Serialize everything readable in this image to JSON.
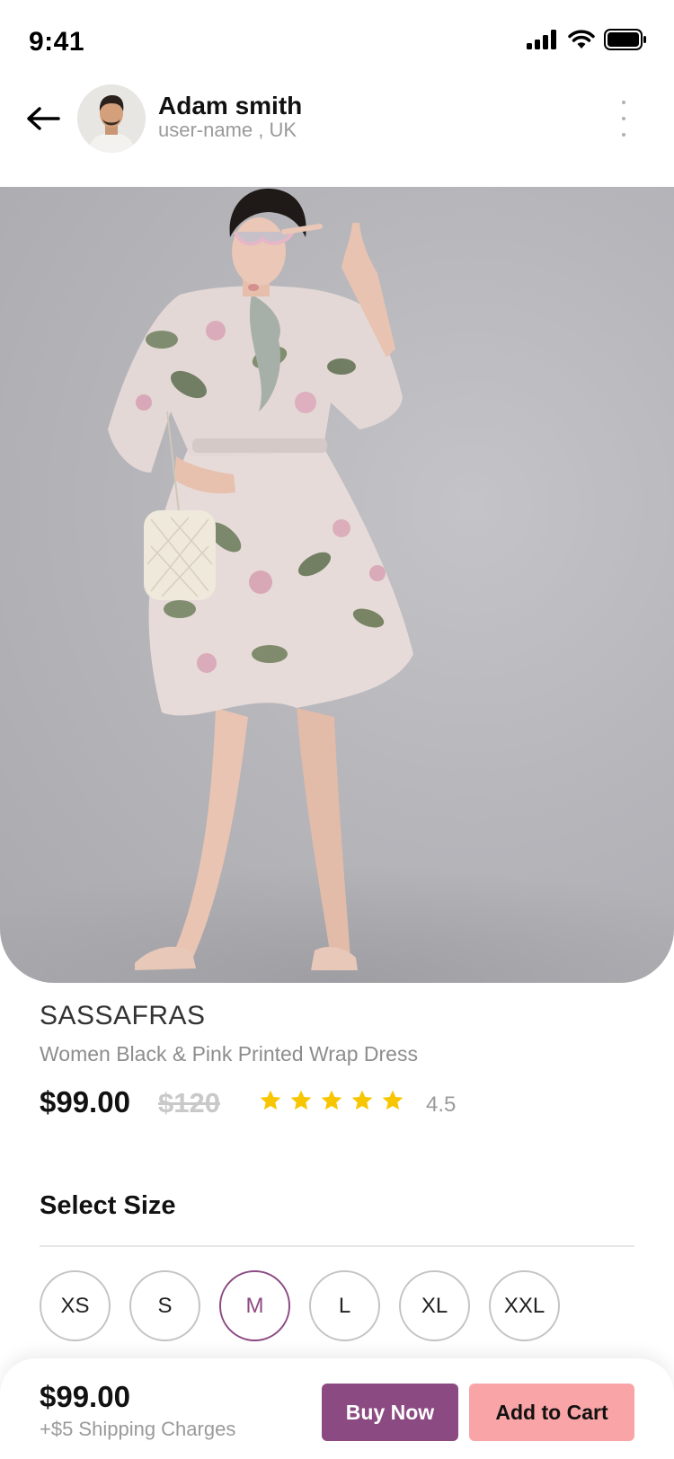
{
  "status_bar": {
    "time": "9:41",
    "icons": [
      "signal-icon",
      "wifi-icon",
      "battery-icon"
    ]
  },
  "header": {
    "back_icon": "arrow-left-icon",
    "user_name": "Adam smith",
    "user_sub": "user-name , UK",
    "more_icon": "more-vertical-icon"
  },
  "product": {
    "brand": "SASSAFRAS",
    "title": "Women Black & Pink Printed Wrap Dress",
    "price": "$99.00",
    "old_price": "$120",
    "stars": 5,
    "rating": "4.5",
    "star_color": "#f7c600"
  },
  "size_section": {
    "heading": "Select Size",
    "sizes": [
      "XS",
      "S",
      "M",
      "L",
      "XL",
      "XXL"
    ],
    "selected": "M"
  },
  "bottom_bar": {
    "price": "$99.00",
    "shipping": "+$5 Shipping Charges",
    "buy_label": "Buy Now",
    "cart_label": "Add to Cart"
  },
  "colors": {
    "accent": "#8c4a82",
    "cart": "#f9a4a6"
  }
}
